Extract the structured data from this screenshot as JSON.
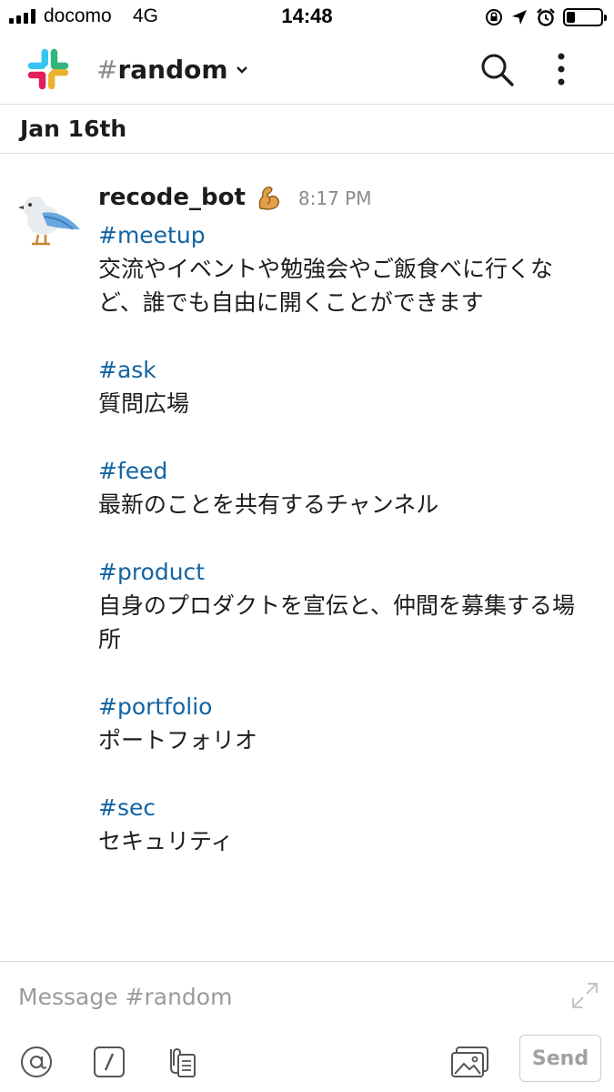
{
  "status_bar": {
    "carrier": "docomo",
    "network": "4G",
    "time": "14:48",
    "battery_level": 0.25
  },
  "header": {
    "channel_hash": "#",
    "channel_name": "random"
  },
  "date_divider": "Jan 16th",
  "message": {
    "sender": "recode_bot",
    "time": "8:17 PM",
    "blocks": [
      {
        "channel": "#meetup",
        "description": "交流やイベントや勉強会やご飯食べに行くなど、誰でも自由に開くことができます"
      },
      {
        "channel": "#ask",
        "description": "質問広場"
      },
      {
        "channel": "#feed",
        "description": "最新のことを共有するチャンネル"
      },
      {
        "channel": "#product",
        "description": "自身のプロダクトを宣伝と、仲間を募集する場所"
      },
      {
        "channel": "#portfolio",
        "description": "ポートフォリオ"
      },
      {
        "channel": "#sec",
        "description": "セキュリティ"
      }
    ]
  },
  "composer": {
    "placeholder": "Message #random",
    "send_label": "Send"
  },
  "icons": {
    "logo": "slack-logo-icon",
    "search": "search-icon",
    "more": "more-vertical-icon",
    "avatar": "bird-avatar",
    "badge": "flexed-biceps-emoji-icon",
    "mention": "at-sign-icon",
    "slash": "slash-command-icon",
    "attach": "attachment-icon",
    "photos": "photo-library-icon",
    "expand": "expand-icon"
  }
}
